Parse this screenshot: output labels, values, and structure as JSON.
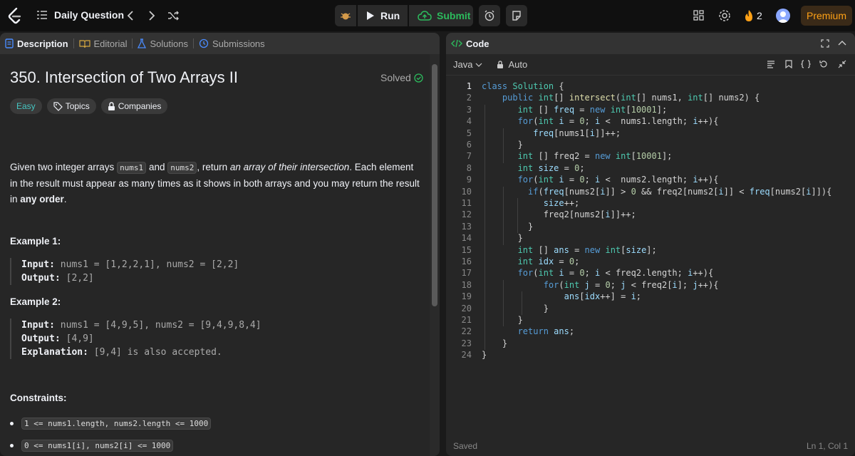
{
  "topbar": {
    "title": "Daily Question",
    "run_label": "Run",
    "submit_label": "Submit",
    "streak_count": "2",
    "premium_label": "Premium"
  },
  "left_tabs": [
    "Description",
    "Editorial",
    "Solutions",
    "Submissions"
  ],
  "problem": {
    "title": "350. Intersection of Two Arrays II",
    "status": "Solved",
    "difficulty": "Easy",
    "tags": [
      "Topics",
      "Companies"
    ],
    "desc_1": "Given two integer arrays ",
    "arr1": "nums1",
    "desc_2": " and ",
    "arr2": "nums2",
    "desc_3": ", return ",
    "desc_em": "an array of their intersection",
    "desc_4": ". Each element in the result must appear as many times as it shows in both arrays and you may return the result in ",
    "desc_bold": "any order",
    "desc_5": ".",
    "ex1_title": "Example 1:",
    "ex1_input_label": "Input:",
    "ex1_input": "nums1 = [1,2,2,1], nums2 = [2,2]",
    "ex1_output_label": "Output:",
    "ex1_output": "[2,2]",
    "ex2_title": "Example 2:",
    "ex2_input_label": "Input:",
    "ex2_input": "nums1 = [4,9,5], nums2 = [9,4,9,8,4]",
    "ex2_output_label": "Output:",
    "ex2_output": "[4,9]",
    "ex2_expl_label": "Explanation:",
    "ex2_expl": "[9,4] is also accepted.",
    "constraints_title": "Constraints:",
    "constraints": [
      "1 <= nums1.length, nums2.length <= 1000",
      "0 <= nums1[i], nums2[i] <= 1000"
    ]
  },
  "code_panel": {
    "title": "Code",
    "language": "Java",
    "mode": "Auto",
    "status_left": "Saved",
    "status_right": "Ln 1, Col 1"
  },
  "code_lines": [
    "class Solution {",
    "    public int[] intersect(int[] nums1, int[] nums2) {",
    "       int [] freq = new int[10001];",
    "       for(int i = 0; i <  nums1.length; i++){",
    "          freq[nums1[i]]++;",
    "       }",
    "       int [] freq2 = new int[10001];",
    "       int size = 0;",
    "       for(int i = 0; i <  nums2.length; i++){",
    "         if(freq[nums2[i]] > 0 && freq2[nums2[i]] < freq[nums2[i]]){",
    "            size++;",
    "            freq2[nums2[i]]++;",
    "         }",
    "       }",
    "       int [] ans = new int[size];",
    "       int idx = 0;",
    "       for(int i = 0; i < freq2.length; i++){",
    "            for(int j = 0; j < freq2[i]; j++){",
    "                ans[idx++] = i;",
    "            }",
    "       }",
    "       return ans;",
    "    }",
    "}"
  ]
}
